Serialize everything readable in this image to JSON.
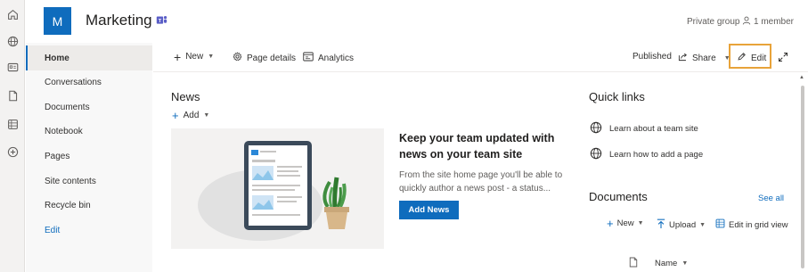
{
  "site": {
    "logo_letter": "M",
    "title": "Marketing",
    "privacy": "Private group",
    "members": "1 member"
  },
  "rail": {
    "icons": [
      "home-icon",
      "globe-icon",
      "news-icon",
      "document-icon",
      "list-icon",
      "add-icon"
    ]
  },
  "nav": {
    "items": [
      {
        "label": "Home"
      },
      {
        "label": "Conversations"
      },
      {
        "label": "Documents"
      },
      {
        "label": "Notebook"
      },
      {
        "label": "Pages"
      },
      {
        "label": "Site contents"
      },
      {
        "label": "Recycle bin"
      },
      {
        "label": "Edit"
      }
    ]
  },
  "commandbar": {
    "new": "New",
    "page_details": "Page details",
    "analytics": "Analytics",
    "published": "Published",
    "share": "Share",
    "edit": "Edit"
  },
  "news": {
    "title": "News",
    "add": "Add",
    "headline": "Keep your team updated with news on your team site",
    "description": "From the site home page you'll be able to quickly author a news post - a status...",
    "add_news_button": "Add News"
  },
  "quick_links": {
    "title": "Quick links",
    "items": [
      {
        "label": "Learn about a team site"
      },
      {
        "label": "Learn how to add a page"
      }
    ]
  },
  "documents": {
    "title": "Documents",
    "see_all": "See all",
    "new": "New",
    "upload": "Upload",
    "grid_view": "Edit in grid view",
    "name_column": "Name"
  },
  "colors": {
    "accent": "#0f6cbd",
    "highlight": "#e8a33a"
  }
}
